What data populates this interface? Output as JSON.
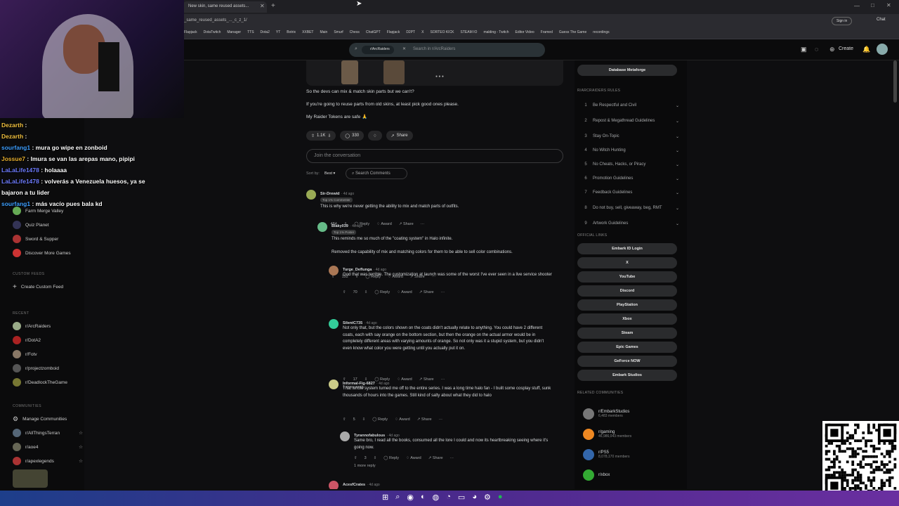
{
  "browser": {
    "tab_title": "New skin, same reused assets...",
    "url": "_same_reused_assets_..._c_z_1/",
    "bookmarks": [
      "Flapjack",
      "DotaTwitch",
      "Manager",
      "TTS",
      "Dota2",
      "YT",
      "Botrix",
      "XXBET",
      "Main",
      "Smurf",
      "Chess",
      "ChatGPT",
      "Flapjack",
      "D2PT",
      "X",
      "SORTEO KICK",
      "STEAM IO",
      "malding - Twitch",
      "Editor Video",
      "Framed",
      "Guess The Game",
      "recordings"
    ],
    "sign_in": "Sign in",
    "chat_label": "Chat"
  },
  "header": {
    "search_chip": "r/ArcRaiders",
    "search_placeholder": "Search in r/ArcRaiders",
    "create": "Create"
  },
  "chat": [
    {
      "user": "Dezarth",
      "msg": " : ",
      "color": "#f0c040"
    },
    {
      "user": "Dezarth",
      "msg": " : ",
      "color": "#f0c040"
    },
    {
      "user": "sourfang1",
      "msg": " : mura go wipe en zonboid",
      "color": "#3fa0ff"
    },
    {
      "user": "Jossue7",
      "msg": " : Imura se van las arepas mano, pipipi",
      "color": "#e8b030"
    },
    {
      "user": "LaLaLife1478",
      "msg": " : holaaaa",
      "color": "#6f7dff"
    },
    {
      "user": "LaLaLife1478",
      "msg": " : volverás a Venezuela huesos, ya se bajaron a tu lider",
      "color": "#6f7dff"
    },
    {
      "user": "sourfang1",
      "msg": " : más vacío pues bala kd",
      "color": "#3fa0ff"
    }
  ],
  "sidebar": {
    "games": [
      "Farm Merge Valley",
      "Quiz Planet",
      "Sword & Supper",
      "Discover More Games"
    ],
    "custom_feeds_label": "CUSTOM FEEDS",
    "create_feed": "Create Custom Feed",
    "recent_label": "RECENT",
    "recent": [
      "r/ArcRaiders",
      "r/DotA2",
      "r/Fotv",
      "r/projectzomboid",
      "r/DeadlockTheGame"
    ],
    "communities_label": "COMMUNITIES",
    "manage": "Manage Communities",
    "communities": [
      "r/AllThingsTerran",
      "r/aoe4",
      "r/apexlegends"
    ]
  },
  "post": {
    "lines": [
      "So the devs can mix & match skin parts but we can't?",
      "If you're going to reuse parts from old skins, at least pick good ones please.",
      "My Raider Tokens are safe 🙏"
    ],
    "votes": "1.1K",
    "comments": "330",
    "share": "Share",
    "join": "Join the conversation",
    "sort_label": "Sort by:",
    "sort_value": "Best",
    "search_comments": "Search Comments"
  },
  "comments": [
    {
      "author": "Sir-Drewid",
      "time": "· 4d ago",
      "flair": "Top 1% Commenter",
      "body": "This is why we're never getting the ability to mix and match parts of outfits.",
      "votes": "484",
      "more": ""
    },
    {
      "author": "Blaky039",
      "time": "· 4d ago",
      "flair": "Top 1% Poster",
      "body": "This reminds me so much of the \"coating system\" in Halo infinite.\n\nRemoved the capability of mix and matching colors for them to be able to sell color combinations.",
      "votes": "192",
      "more": ""
    },
    {
      "author": "Turge_Deflunga",
      "time": "· 4d ago",
      "flair": "",
      "body": "God that was terrible. The customization at launch was some of the worst I've ever seen in a live service shooter",
      "votes": "70",
      "more": ""
    },
    {
      "author": "SilentC735",
      "time": "· 4d ago",
      "flair": "",
      "body": "Not only that, but the colors shown on the coats didn't actually relate to anything. You could have 2 different coats, each with say orange on the bottom section, but then the orange on the actual armor would be in completely different areas with varying amounts of orange. So not only was it a stupid system, but you didn't even know what color you were getting until you actually put it on.",
      "votes": "17",
      "more": "1 more reply"
    },
    {
      "author": "Informal-Fig-6827",
      "time": "· 4d ago",
      "flair": "",
      "body": "That whole system turned me off to the entire series. I was a long time halo fan - I built some cosplay stuff, sunk thousands of hours into the games. Still kind of salty about what they did to halo",
      "votes": "5",
      "more": ""
    },
    {
      "author": "Tyrannofabulous",
      "time": "· 4d ago",
      "flair": "",
      "body": "Same bro, I read all the books, consumed all the lore I could and now its heartbreaking seeing where it's going now.",
      "votes": "3",
      "more": "1 more reply"
    },
    {
      "author": "AcesfCrates",
      "time": "· 4d ago",
      "flair": "",
      "body": "",
      "votes": "",
      "more": ""
    }
  ],
  "actions": {
    "reply": "Reply",
    "award": "Award",
    "share": "Share"
  },
  "right": {
    "db_button": "Database Metaforge",
    "rules_label": "R/ARCRAIDERS RULES",
    "rules": [
      "Be Respectful and Civil",
      "Repost & Megathread Guidelines",
      "Stay On-Topic",
      "No Witch Hunting",
      "No Cheats, Hacks, or Piracy",
      "Promotion Guidelines",
      "Feedback Guidelines",
      "Do not buy, sell, giveaway, beg, RMT",
      "Artwork Guidelines"
    ],
    "links_label": "OFFICIAL LINKS",
    "links": [
      "Embark ID Login",
      "X",
      "YouTube",
      "Discord",
      "PlayStation",
      "Xbox",
      "Steam",
      "Epic Games",
      "GeForce NOW",
      "Embark Studios"
    ],
    "related_label": "RELATED COMMUNITIES",
    "related": [
      {
        "name": "r/EmbarkStudios",
        "members": "6,483 members"
      },
      {
        "name": "r/gaming",
        "members": "46,986,043 members"
      },
      {
        "name": "r/PS5",
        "members": "8,078,170 members"
      },
      {
        "name": "r/xbox",
        "members": ""
      }
    ]
  },
  "colors": {
    "accent": "#ff4500",
    "upvote": "#ff4500"
  }
}
